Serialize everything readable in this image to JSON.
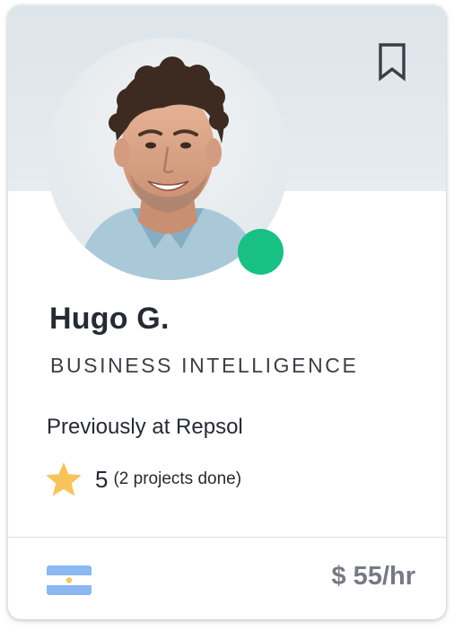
{
  "profile": {
    "name": "Hugo G.",
    "role": "BUSINESS INTELLIGENCE",
    "previous": "Previously at Repsol",
    "online": true,
    "avatar_icon": "person-portrait",
    "bookmark_icon": "bookmark-outline-icon"
  },
  "rating": {
    "score": "5",
    "projects": "(2 projects done)",
    "star_icon": "star-icon"
  },
  "footer": {
    "country_flag": "argentina-flag-icon",
    "rate": "$ 55/hr"
  },
  "colors": {
    "banner": "#e3e9ed",
    "online": "#18c084",
    "star": "#f7c35c",
    "text": "#262a33",
    "rate": "#767a83",
    "flag_blue": "#8cb8f2"
  }
}
